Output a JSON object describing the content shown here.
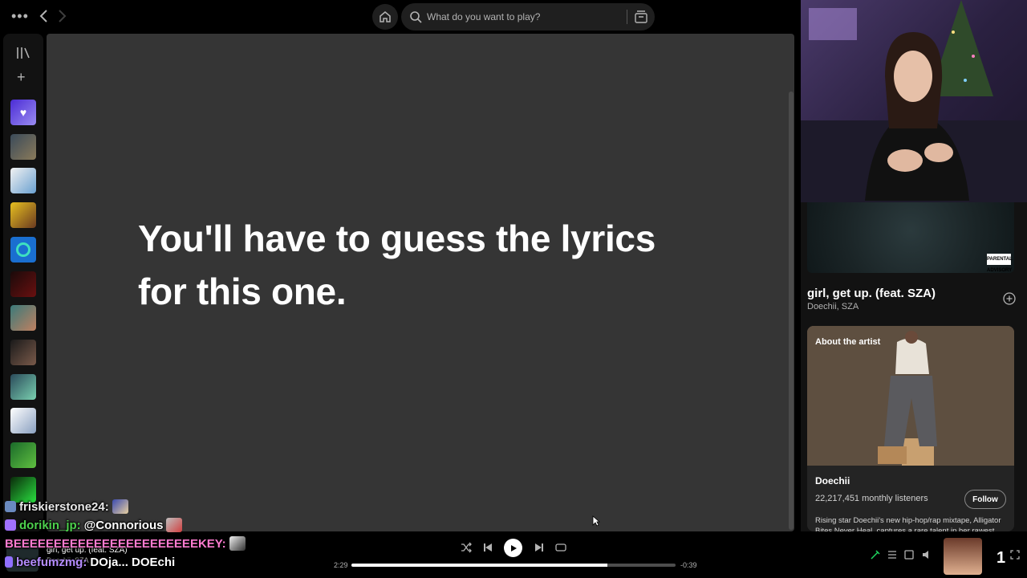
{
  "topbar": {
    "search_placeholder": "What do you want to play?"
  },
  "main": {
    "lyrics_message_line1": "You'll have to guess the lyrics",
    "lyrics_message_line2": "for this one."
  },
  "right_panel": {
    "song_title": "girl, get up. (feat. SZA)",
    "song_artists": "Doechii, SZA",
    "about_title": "About the artist",
    "artist_name": "Doechii",
    "monthly_listeners": "22,217,451 monthly listeners",
    "follow_label": "Follow",
    "bio": "Rising star Doechii's new hip-hop/rap mixtape, Alligator Bites Never Heal, captures a rare talent in her rawest"
  },
  "player": {
    "now_title": "girl, get up. (feat. SZA)",
    "now_artist": "Doechii, SZA",
    "elapsed": "2:29",
    "remaining": "-0:39",
    "progress": 0.79
  },
  "chat": [
    {
      "user": "friskierstone24:",
      "message": "",
      "user_color": "#e8e8e8"
    },
    {
      "user": "dorikin_jp:",
      "message": "@Connorious",
      "user_color": "#4dd14d"
    },
    {
      "user": "BEEEEEEEEEEEEEEEEEEEEEEEKEY:",
      "message": "",
      "user_color": "#ff7bd0"
    },
    {
      "user": "beefumzmg:",
      "message": "DOja... DOEchi",
      "user_color": "#b58cff"
    }
  ],
  "colors": {
    "accent": "#1ed760",
    "main_bg": "#353535",
    "panel_bg": "#121212"
  },
  "misc": {
    "overlay_counter": "1"
  }
}
